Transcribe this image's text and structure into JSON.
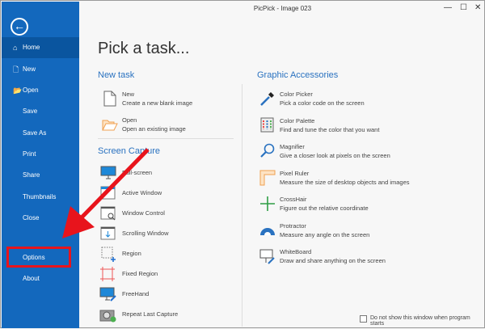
{
  "window": {
    "title": "PicPick - Image 023",
    "minimize": "—",
    "maximize": "☐",
    "close": "✕"
  },
  "sidebar": {
    "back": "←",
    "items": [
      {
        "label": "Home",
        "icon": "⌂"
      },
      {
        "label": "New",
        "icon": "🗋"
      },
      {
        "label": "Open",
        "icon": "📂"
      },
      {
        "label": "Save"
      },
      {
        "label": "Save As"
      },
      {
        "label": "Print"
      },
      {
        "label": "Share"
      },
      {
        "label": "Thumbnails"
      },
      {
        "label": "Close"
      },
      {
        "label": "Options"
      },
      {
        "label": "About"
      }
    ]
  },
  "main": {
    "heading": "Pick a task...",
    "new_task": {
      "title": "New task",
      "items": [
        {
          "name": "New",
          "desc": "Create a new blank image"
        },
        {
          "name": "Open",
          "desc": "Open an existing image"
        }
      ]
    },
    "screen_capture": {
      "title": "Screen Capture",
      "items": [
        "Full-screen",
        "Active Window",
        "Window Control",
        "Scrolling Window",
        "Region",
        "Fixed Region",
        "FreeHand",
        "Repeat Last Capture"
      ]
    },
    "accessories": {
      "title": "Graphic Accessories",
      "items": [
        {
          "name": "Color Picker",
          "desc": "Pick a color code on the screen"
        },
        {
          "name": "Color Palette",
          "desc": "Find and tune the color that you want"
        },
        {
          "name": "Magnifier",
          "desc": "Give a closer look at pixels on the screen"
        },
        {
          "name": "Pixel Ruler",
          "desc": "Measure the size of desktop objects and images"
        },
        {
          "name": "CrossHair",
          "desc": "Figure out the relative coordinate"
        },
        {
          "name": "Protractor",
          "desc": "Measure any angle on the screen"
        },
        {
          "name": "WhiteBoard",
          "desc": "Draw and share anything on the screen"
        }
      ]
    },
    "dont_show": "Do not show this window when program starts"
  },
  "colors": {
    "sidebar": "#1368bd",
    "accent": "#2a72c0",
    "annotation": "#e8141c"
  }
}
